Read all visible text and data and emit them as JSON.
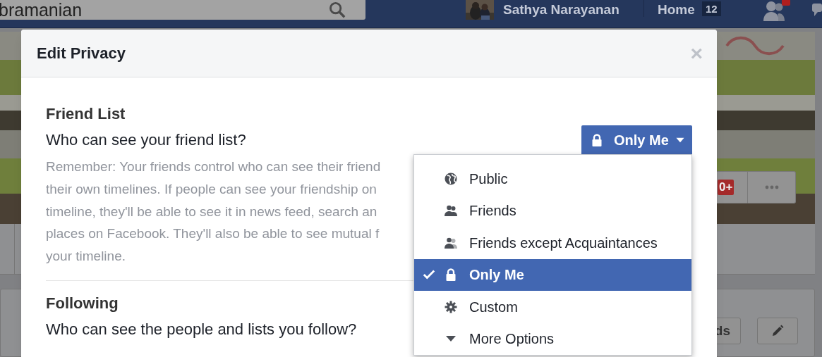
{
  "top_bar": {
    "search": {
      "value": "bramanian"
    },
    "profile_name": "Sathya Narayanan",
    "home": {
      "label": "Home",
      "count": "12"
    }
  },
  "cover": {
    "badge": "0+"
  },
  "profile_actions": {
    "button_text": "ds"
  },
  "dialog": {
    "title": "Edit Privacy",
    "close": "×",
    "sections": [
      {
        "heading": "Friend List",
        "question": "Who can see your friend list?",
        "description_lines": [
          "Remember: Your friends control who can see their friend",
          "their own timelines. If people can see your friendship on",
          "timeline, they'll be able to see it in news feed, search an",
          "places on Facebook. They'll also be able to see mutual f",
          "your timeline."
        ],
        "audience": {
          "label": "Only Me",
          "kind": "lock"
        }
      },
      {
        "heading": "Following",
        "question": "Who can see the people and lists you follow?"
      }
    ],
    "audience_menu": {
      "items": [
        {
          "label": "Public",
          "kind": "globe",
          "selected": false
        },
        {
          "label": "Friends",
          "kind": "friends",
          "selected": false
        },
        {
          "label": "Friends except Acquaintances",
          "kind": "friends-except",
          "selected": false
        },
        {
          "label": "Only Me",
          "kind": "lock",
          "selected": true
        },
        {
          "label": "Custom",
          "kind": "gear",
          "selected": false
        },
        {
          "label": "More Options",
          "kind": "caret",
          "selected": false
        }
      ]
    }
  }
}
